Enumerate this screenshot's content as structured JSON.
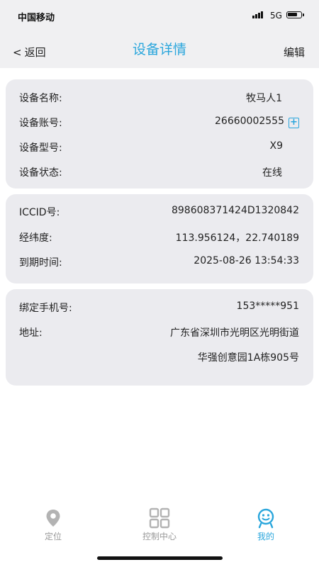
{
  "status_bar": {
    "carrier": "中国移动",
    "network": "5G",
    "battery_level": 0.75
  },
  "nav": {
    "back_label": "返回",
    "title": "设备详情",
    "edit_label": "编辑"
  },
  "device_card": {
    "name_label": "设备名称:",
    "name_value": "牧马人1",
    "account_label": "设备账号:",
    "account_value": "26660002555",
    "model_label": "设备型号:",
    "model_value": "X9",
    "state_label": "设备状态:",
    "state_value": "在线"
  },
  "sim_card": {
    "iccid_label": "ICCID号:",
    "iccid_value": "898608371424D1320842",
    "coord_label": "经纬度:",
    "coord_value": "113.956124，22.740189",
    "expire_label": "到期时间:",
    "expire_value": "2025-08-26 13:54:33"
  },
  "owner_card": {
    "phone_label": "绑定手机号:",
    "phone_value": "153*****951",
    "address_label": "地址:",
    "address_line1": "广东省深圳市光明区光明街道",
    "address_line2": "华强创意园1A栋905号"
  },
  "tabs": [
    {
      "label": "定位",
      "icon": "location-pin-icon"
    },
    {
      "label": "控制中心",
      "icon": "grid-icon"
    },
    {
      "label": "我的",
      "icon": "smiley-user-icon"
    }
  ],
  "colors": {
    "accent": "#2aa6dc",
    "card_bg": "#ebebef",
    "bar_bg": "#f0f0f2",
    "muted": "#999999"
  }
}
